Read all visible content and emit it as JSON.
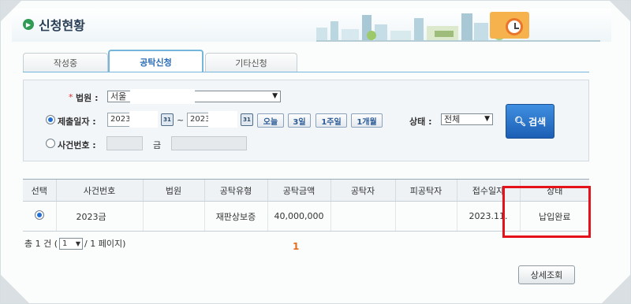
{
  "header": {
    "title": "신청현황"
  },
  "tabs": [
    {
      "label": "작성중"
    },
    {
      "label": "공탁신청"
    },
    {
      "label": "기타신청"
    }
  ],
  "search": {
    "court_label": "법원 :",
    "court_value": "서울",
    "submit_date_label": "제출일자 :",
    "date_from": "2023.",
    "tilde": "~",
    "date_to": "2023",
    "calendar_icon_text": "31",
    "period_buttons": [
      "오늘",
      "3일",
      "1주일",
      "1개월"
    ],
    "status_label": "상태 :",
    "status_value": "전체",
    "case_no_label": "사건번호 :",
    "case_suffix": "금",
    "search_button": "검색",
    "selected_mode": "submit_date"
  },
  "table": {
    "columns": [
      "선택",
      "사건번호",
      "법원",
      "공탁유형",
      "공탁금액",
      "공탁자",
      "피공탁자",
      "접수일자",
      "상태"
    ],
    "rows": [
      {
        "case_no": "2023금",
        "court": "",
        "type": "재판상보증",
        "amount": "40,000,000",
        "depositor": "",
        "depositee": "",
        "received": "2023.11.",
        "status": "납입완료",
        "selected": true
      }
    ]
  },
  "pager": {
    "total_prefix": "총 1 건 (",
    "page_value": "1",
    "page_suffix": "/ 1 페이지)",
    "current_page": "1"
  },
  "footer": {
    "detail_button": "상세조회"
  },
  "colors": {
    "highlight": "#e5121b",
    "accent": "#2a6db5",
    "status_link": "#1f57b8",
    "page_num": "#e56d1e"
  }
}
